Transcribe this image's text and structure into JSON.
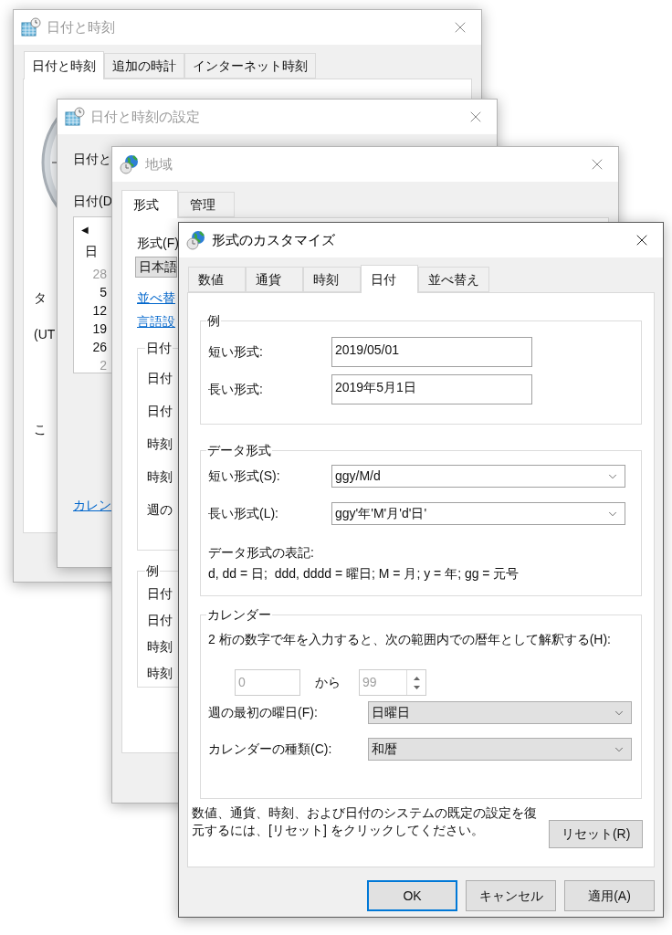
{
  "date_time_window": {
    "title": "日付と時刻",
    "active": false,
    "tabs": [
      {
        "label": "日付と時刻",
        "selected": true
      },
      {
        "label": "追加の時計",
        "selected": false
      },
      {
        "label": "インターネット時刻",
        "selected": false
      }
    ],
    "clipped_labels": [
      "タ",
      "(UT",
      "こ"
    ]
  },
  "date_time_settings_window": {
    "title": "日付と時刻の設定",
    "active": false,
    "heading": "日付と",
    "date_label": "日付(D",
    "calendar": {
      "prev_button": "◀",
      "weekday": "日",
      "days": [
        {
          "label": "28",
          "other_month": true
        },
        {
          "label": "5",
          "other_month": false
        },
        {
          "label": "12",
          "other_month": false
        },
        {
          "label": "19",
          "other_month": false
        },
        {
          "label": "26",
          "other_month": false
        },
        {
          "label": "2",
          "other_month": true
        }
      ]
    },
    "link": "カレン"
  },
  "region_window": {
    "title": "地域",
    "active": false,
    "tabs": [
      {
        "label": "形式",
        "selected": true
      },
      {
        "label": "管理",
        "selected": false
      }
    ],
    "format_label": "形式(F)",
    "format_value": "日本語",
    "links": [
      "並べ替",
      "言語設"
    ],
    "groups": [
      {
        "title": "日付",
        "labels": [
          "日付",
          "日付",
          "時刻",
          "時刻",
          "週の"
        ]
      },
      {
        "title": "例",
        "labels": [
          "日付",
          "日付",
          "時刻",
          "時刻"
        ]
      }
    ]
  },
  "customize_dialog": {
    "title": "形式のカスタマイズ",
    "active": true,
    "tabs": [
      {
        "label": "数値",
        "selected": false
      },
      {
        "label": "通貨",
        "selected": false
      },
      {
        "label": "時刻",
        "selected": false
      },
      {
        "label": "日付",
        "selected": true
      },
      {
        "label": "並べ替え",
        "selected": false
      }
    ],
    "example": {
      "title": "例",
      "rows": [
        {
          "label": "短い形式:",
          "value": "2019/05/01"
        },
        {
          "label": "長い形式:",
          "value": "2019年5月1日"
        }
      ]
    },
    "data_format": {
      "title": "データ形式",
      "rows": [
        {
          "label": "短い形式(S):",
          "value": "ggy/M/d"
        },
        {
          "label": "長い形式(L):",
          "value": "ggy'年'M'月'd'日'"
        }
      ],
      "notation_title": "データ形式の表記:",
      "notation": "d, dd = 日;  ddd, dddd = 曜日; M = 月; y = 年; gg = 元号"
    },
    "calendar": {
      "title": "カレンダー",
      "description": "2 桁の数字で年を入力すると、次の範囲内での暦年として解釈する(H):",
      "range_from": {
        "value": "0",
        "disabled": true
      },
      "range_connector": "から",
      "range_to": {
        "value": "99",
        "disabled": true
      },
      "rows": [
        {
          "label": "週の最初の曜日(F):",
          "value": "日曜日"
        },
        {
          "label": "カレンダーの種類(C):",
          "value": "和暦"
        }
      ]
    },
    "reset_note": "数値、通貨、時刻、および日付のシステムの既定の設定を復元するには、[リセット] をクリックしてください。",
    "reset_button": "リセット(R)",
    "buttons": [
      {
        "label": "OK",
        "default": true
      },
      {
        "label": "キャンセル",
        "default": false
      },
      {
        "label": "適用(A)",
        "default": false
      }
    ]
  }
}
